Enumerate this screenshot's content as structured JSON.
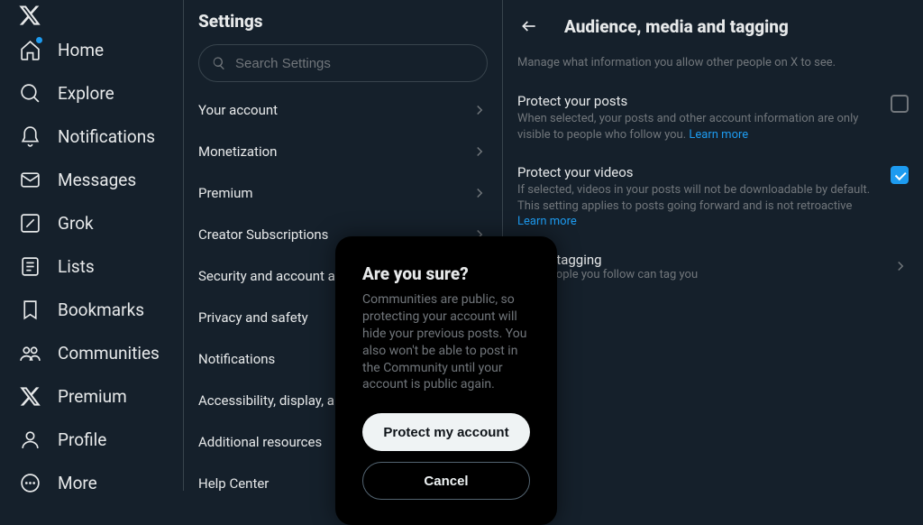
{
  "nav": {
    "items": [
      {
        "key": "home",
        "label": "Home",
        "dot": true
      },
      {
        "key": "explore",
        "label": "Explore"
      },
      {
        "key": "notifications",
        "label": "Notifications"
      },
      {
        "key": "messages",
        "label": "Messages"
      },
      {
        "key": "grok",
        "label": "Grok"
      },
      {
        "key": "lists",
        "label": "Lists"
      },
      {
        "key": "bookmarks",
        "label": "Bookmarks"
      },
      {
        "key": "communities",
        "label": "Communities"
      },
      {
        "key": "premium",
        "label": "Premium"
      },
      {
        "key": "profile",
        "label": "Profile"
      },
      {
        "key": "more",
        "label": "More"
      }
    ]
  },
  "settings": {
    "heading": "Settings",
    "search_placeholder": "Search Settings",
    "items": [
      "Your account",
      "Monetization",
      "Premium",
      "Creator Subscriptions",
      "Security and account access",
      "Privacy and safety",
      "Notifications",
      "Accessibility, display, and languages",
      "Additional resources",
      "Help Center"
    ]
  },
  "detail": {
    "heading": "Audience, media and tagging",
    "subheading": "Manage what information you allow other people on X to see.",
    "protect_posts": {
      "title": "Protect your posts",
      "desc": "When selected, your posts and other account information are only visible to people who follow you. ",
      "link": "Learn more",
      "checked": false
    },
    "protect_videos": {
      "title": "Protect your videos",
      "desc": "If selected, videos in your posts will not be downloadable by default. This setting applies to posts going forward and is not retroactive ",
      "link": "Learn more",
      "checked": true
    },
    "photo_tagging": {
      "title": "Photo tagging",
      "desc": "Only people you follow can tag you"
    }
  },
  "modal": {
    "title": "Are you sure?",
    "body": "Communities are public, so protecting your account will hide your previous posts. You also won't be able to post in the Community until your account is public again.",
    "primary": "Protect my account",
    "secondary": "Cancel"
  }
}
